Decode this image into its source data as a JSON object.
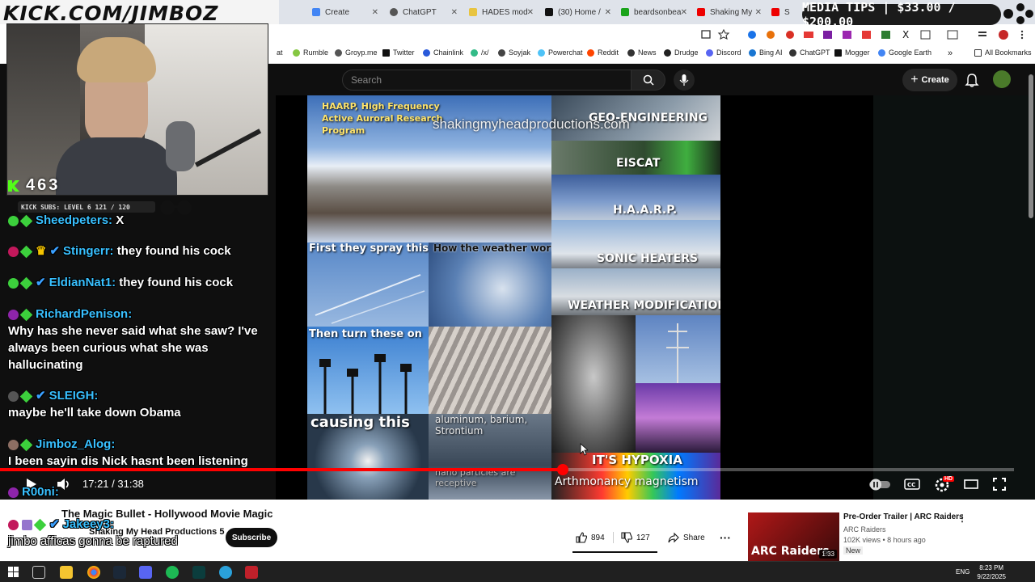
{
  "browser": {
    "tabs": [
      {
        "label": "Create",
        "color": "#4285f4"
      },
      {
        "label": "ChatGPT",
        "color": "#444"
      },
      {
        "label": "HADES mod",
        "color": "#e8c440"
      },
      {
        "label": "(30) Home /",
        "color": "#111"
      },
      {
        "label": "beardsonbea",
        "color": "#1aa31a"
      },
      {
        "label": "Shaking My",
        "color": "#e00"
      },
      {
        "label": "S",
        "color": "#e00"
      }
    ],
    "bookmarks": [
      "Rumble",
      "Groyp.me",
      "Twitter",
      "Chainlink",
      "/x/",
      "Soyjak",
      "Powerchat",
      "Reddit",
      "News",
      "Drudge",
      "Discord",
      "Bing AI",
      "ChatGPT",
      "Mogger",
      "Google Earth",
      "All Bookmarks"
    ],
    "bookmark_partial": "at"
  },
  "youtube": {
    "search_placeholder": "Search",
    "create_label": "Create",
    "video_title": "The Magic Bullet - Hollywood Movie Magic",
    "channel": "Shaking My Head Productions 5",
    "subscribe_label": "Subscribe",
    "likes": "894",
    "dislikes": "127",
    "share_label": "Share",
    "time_current": "17:21",
    "time_total": "31:38",
    "time_display": "17:21 / 31:38",
    "progress_fraction": 0.555,
    "watermark": "shakingmyheadproductions.com",
    "hd_badge": "HD"
  },
  "collage": {
    "haarp_title": "HAARP, High Frequency Active Auroral Research Program",
    "geo": "GEO-ENGINEERING",
    "eiscat": "EISCAT",
    "haarp": "H.A.A.R.P.",
    "spray": "First they spray this",
    "weather_works": "How the weather works",
    "sonic": "SONIC HEATERS",
    "weather_mod": "WEATHER MODIFICATION",
    "turn_on": "Then turn these on",
    "causing": "causing this",
    "aluminum": "aluminum, barium, Strontium",
    "nano": "nano particles are receptive",
    "hypoxia": "IT'S HYPOXIA",
    "arthmonancy": "Arthmonancy magnetism"
  },
  "recommended": {
    "title": "Pre-Order Trailer | ARC Raiders",
    "channel": "ARC Raiders",
    "meta": "102K views • 8 hours ago",
    "badge": "New",
    "duration": "1:33",
    "thumb_text": "ARC Raiders"
  },
  "overlay": {
    "kick_url": "KICK.COM/JIMBOZ",
    "viewers": "463",
    "kick_subs": "KICK SUBS: LEVEL 6 121 / 120",
    "media_tips": "MEDIA TIPS | $33.00 / $200.00"
  },
  "chat": [
    {
      "user": "Sheedpeters:",
      "text": "X"
    },
    {
      "user": "Stingerr:",
      "text": "they found his cock"
    },
    {
      "user": "EldianNat1:",
      "text": "they found his cock"
    },
    {
      "user": "RichardPenison:",
      "text": "Why has she never said what she saw? I've always been curious what she was hallucinating"
    },
    {
      "user": "SLEIGH:",
      "text": "maybe he'll take down Obama"
    },
    {
      "user": "Jimboz_Alog:",
      "text": "I been sayin dis Nick hasnt been listening"
    },
    {
      "user": "R00ni:",
      "text": ""
    },
    {
      "user": "Jakeey3:",
      "text": "jimbo afficas gonna be raptured"
    }
  ],
  "taskbar": {
    "lang": "ENG",
    "time": "8:23 PM",
    "date": "9/22/2025"
  },
  "colors": {
    "youtube_red": "#ff0000",
    "chat_username": "#38c0ff",
    "kick_green": "#3cd03c"
  }
}
